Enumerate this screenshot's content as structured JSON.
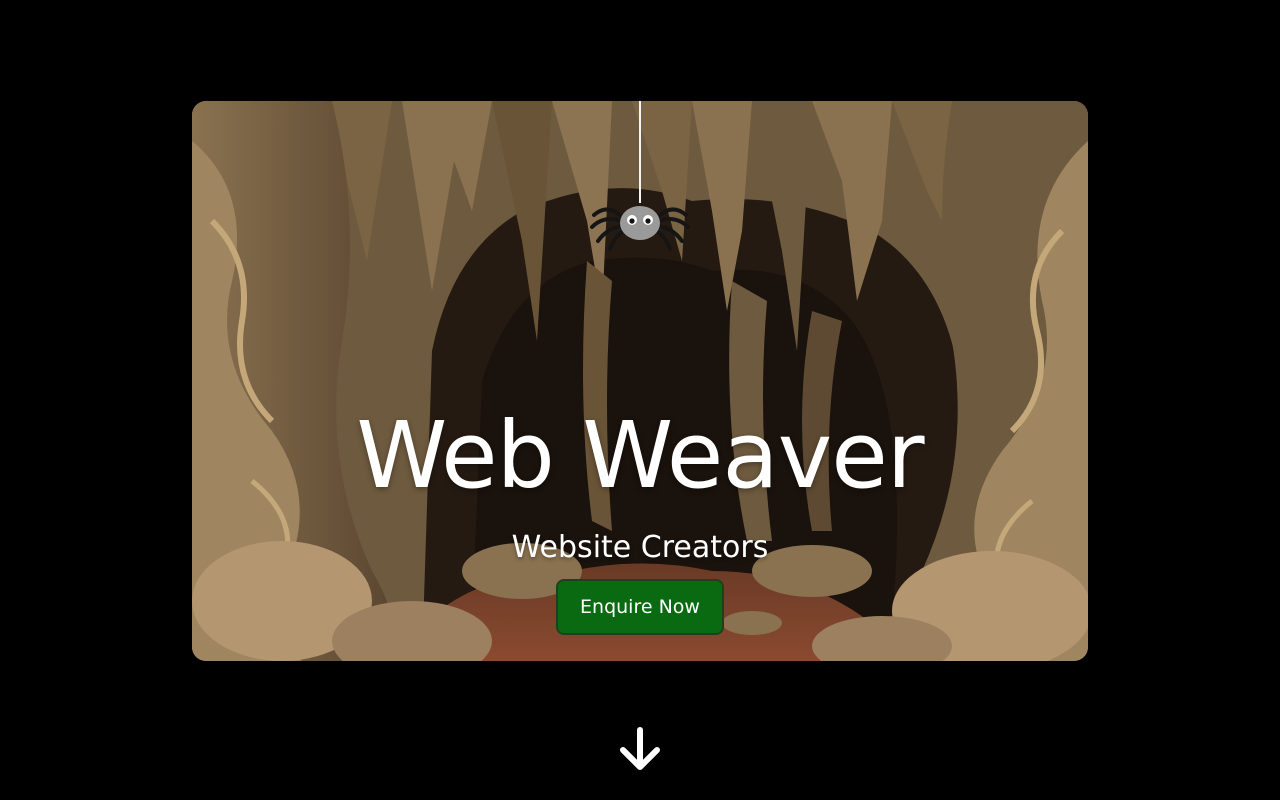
{
  "hero": {
    "title": "Web Weaver",
    "subtitle": "Website Creators",
    "cta_label": "Enquire Now",
    "background": "cave-illustration"
  },
  "colors": {
    "page_background": "#000000",
    "cta_background": "#0a6a12",
    "text": "#ffffff"
  },
  "icons": {
    "spider": "spider-icon",
    "scroll": "arrow-down-icon"
  }
}
